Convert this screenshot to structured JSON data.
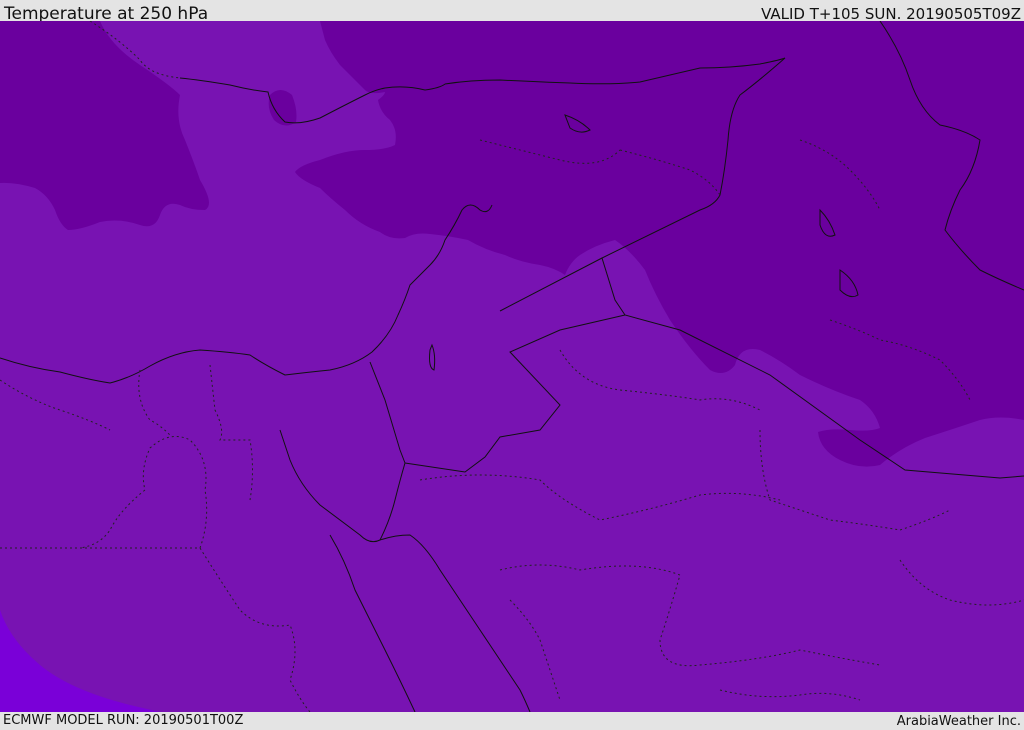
{
  "header": {
    "title": "Temperature at 250 hPa",
    "valid_time": "VALID T+105 SUN. 20190505T09Z"
  },
  "footer": {
    "model_run": "ECMWF MODEL RUN: 20190501T00Z",
    "credit": "ArabiaWeather Inc."
  },
  "map": {
    "region": "Eastern Mediterranean and Middle East",
    "field": "temperature",
    "level_hpa": 250,
    "colors": {
      "cold_zone": "#6800a0",
      "mid_zone": "#7813b2",
      "warm_zone": "#7a00d8",
      "country_border": "#111111",
      "province_border": "#222222"
    }
  }
}
